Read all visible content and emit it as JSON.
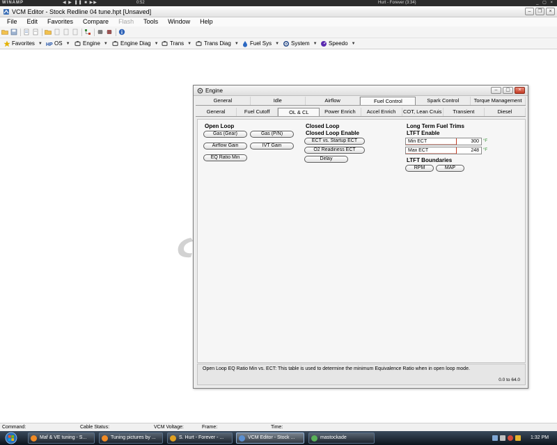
{
  "winamp": {
    "logo": "WINAMP",
    "time": "0:52",
    "track": "Hurt - Forever (3:34)",
    "controls": "◀ ▶ ❚❚ ■ ▶▶"
  },
  "titlebar": {
    "title": "VCM Editor - Stock Redline 04 tune.hpt   [Unsaved]"
  },
  "menu": {
    "items": [
      "File",
      "Edit",
      "Favorites",
      "Compare",
      "Flash",
      "Tools",
      "Window",
      "Help"
    ],
    "disabled": [
      "Flash"
    ]
  },
  "toolbar_icons": [
    "open-folder",
    "save",
    "document",
    "document",
    "open-folder",
    "document",
    "document",
    "document",
    "tree",
    "chip",
    "chip",
    "info"
  ],
  "categories": [
    {
      "label": "Favorites",
      "icon": "star-icon",
      "color": "#e3b100"
    },
    {
      "label": "OS",
      "icon": "hp-icon",
      "prefix": "HP",
      "color": "#1d4fa6"
    },
    {
      "label": "Engine",
      "icon": "engine-icon",
      "color": "#555555"
    },
    {
      "label": "Engine Diag",
      "icon": "engine-diag-icon",
      "color": "#555555"
    },
    {
      "label": "Trans",
      "icon": "trans-icon",
      "color": "#555555"
    },
    {
      "label": "Trans Diag",
      "icon": "trans-diag-icon",
      "color": "#555555"
    },
    {
      "label": "Fuel Sys",
      "icon": "fuel-icon",
      "color": "#2b68c2"
    },
    {
      "label": "System",
      "icon": "system-icon",
      "color": "#2b4f8c"
    },
    {
      "label": "Speedo",
      "icon": "speedo-icon",
      "color": "#5b2bb0"
    }
  ],
  "engine_window": {
    "title": "Engine",
    "tabs_row1": [
      "General",
      "Idle",
      "Airflow",
      "Fuel Control",
      "Spark Control",
      "Torque Management"
    ],
    "tabs_row1_active": "Fuel Control",
    "tabs_row2": [
      "General",
      "Fuel Cutoff",
      "OL & CL",
      "Power Enrich",
      "Accel Enrich",
      "COT, Lean Cruis",
      "Transient",
      "Diesel"
    ],
    "tabs_row2_active": "OL & CL",
    "open_loop": {
      "heading": "Open Loop",
      "buttons": [
        "Gas (Gear)",
        "Gas (P/N)",
        "Airflow Gain",
        "IVT Gain",
        "EQ Ratio Min"
      ]
    },
    "closed_loop": {
      "heading": "Closed Loop",
      "subheading": "Closed Loop Enable",
      "buttons": [
        "ECT vs. Startup ECT",
        "O2 Readiness ECT",
        "Delay"
      ]
    },
    "ltft": {
      "heading": "Long Term Fuel Trims",
      "enable_heading": "LTFT Enable",
      "fields": [
        {
          "label": "Min ECT",
          "value": "300",
          "unit": "°F"
        },
        {
          "label": "Max ECT",
          "value": "248",
          "unit": "°F"
        }
      ],
      "boundaries_heading": "LTFT Boundaries",
      "boundary_buttons": [
        "RPM",
        "MAP"
      ]
    },
    "description": "Open Loop EQ Ratio Min vs. ECT: This table is used to determine the minimum Equivalence Ratio when in open loop mode.",
    "range": "0.0 to 64.0"
  },
  "statusbar": {
    "command": "Command:",
    "cable": "Cable Status:",
    "voltage": "VCM Voltage:",
    "frame": "Frame:",
    "time": "Time:"
  },
  "taskbar": {
    "tasks": [
      {
        "label": "Maf & VE tuning - S...",
        "active": false
      },
      {
        "label": "Tuning pictures by ...",
        "active": false
      },
      {
        "label": "S. Hurt - Forever - ...",
        "active": false
      },
      {
        "label": "VCM Editor - Stock ...",
        "active": true
      },
      {
        "label": "mastockade",
        "active": false
      }
    ],
    "clock": "1:32 PM"
  },
  "colors": {
    "accent_red": "#c43b23",
    "unit_green": "#2d8c2d",
    "taskbar_dark": "#0d141c"
  }
}
